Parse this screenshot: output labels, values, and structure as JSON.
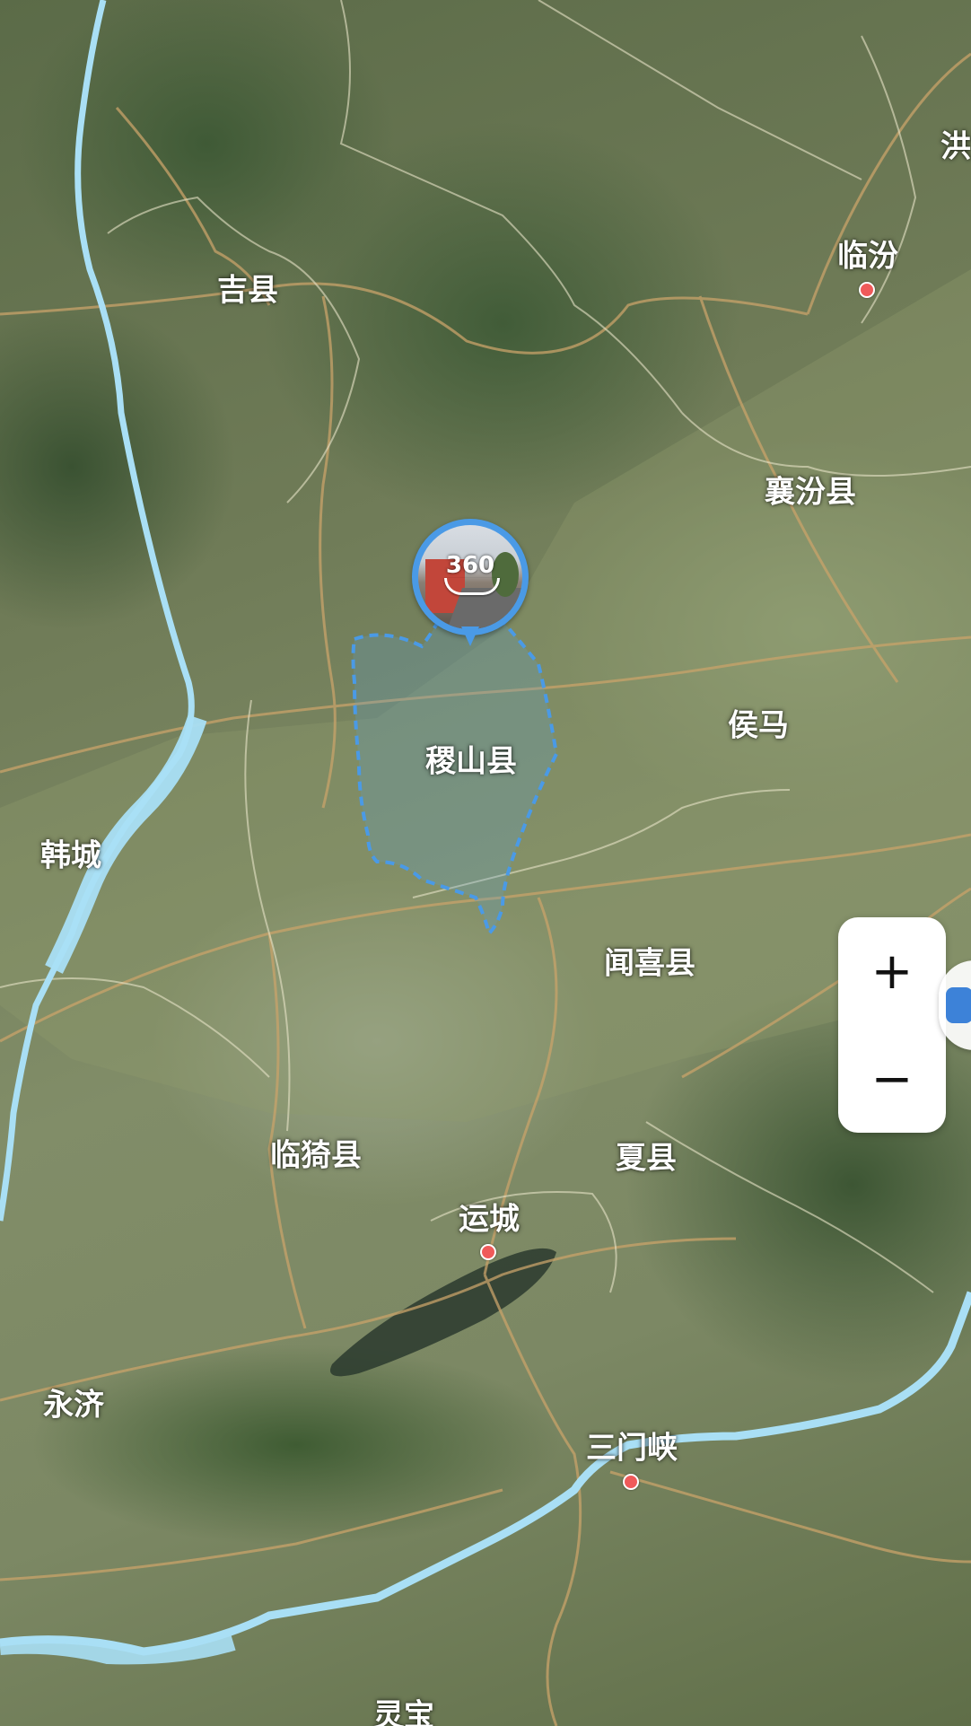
{
  "colors": {
    "river": "#a9dff5",
    "road": "#c9a36a",
    "boundary": "#e8e4c8",
    "county_outline": "#4a9ae6",
    "city_dot": "#ef5a5a",
    "label": "#ffffff"
  },
  "labels": {
    "jixian": "吉县",
    "linfen": "临汾",
    "hong": "洪洞",
    "xiangfen": "襄汾县",
    "houma": "侯马",
    "jishan": "稷山县",
    "hancheng": "韩城",
    "wenxi": "闻喜县",
    "linyi": "临猗县",
    "xiaxian": "夏县",
    "yuncheng": "运城",
    "yongji": "永济",
    "sanmenxia": "三门峡",
    "lingbao": "灵宝"
  },
  "panorama_pin": {
    "badge": "360",
    "icon": "panorama-360-icon"
  },
  "zoom_controls": {
    "zoom_in": "+",
    "zoom_out": "−"
  }
}
